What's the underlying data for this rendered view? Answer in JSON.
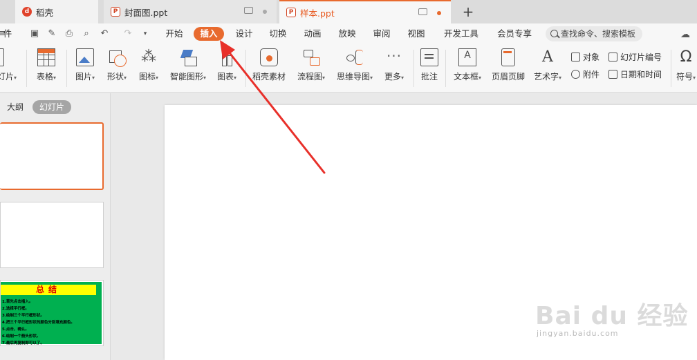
{
  "tabs": [
    {
      "label": "稻壳",
      "icon": "daoke-icon"
    },
    {
      "label": "封面图.ppt",
      "icon": "ppt-file-icon"
    },
    {
      "label": "样本.ppt",
      "icon": "ppt-file-icon",
      "active": true
    }
  ],
  "menu": {
    "file_partial": "件",
    "items": [
      "开始",
      "插入",
      "设计",
      "切换",
      "动画",
      "放映",
      "审阅",
      "视图",
      "开发工具",
      "会员专享"
    ],
    "active": "插入",
    "search_placeholder": "查找命令、搜索模板"
  },
  "ribbon": {
    "buttons": [
      {
        "label": "灯片",
        "icon": "new-slide-icon"
      },
      {
        "label": "表格",
        "icon": "table-icon"
      },
      {
        "label": "图片",
        "icon": "picture-icon"
      },
      {
        "label": "形状",
        "icon": "shape-icon"
      },
      {
        "label": "图标",
        "icon": "icons-icon"
      },
      {
        "label": "智能图形",
        "icon": "smartart-icon"
      },
      {
        "label": "图表",
        "icon": "chart-icon"
      },
      {
        "label": "稻壳素材",
        "icon": "material-icon"
      },
      {
        "label": "流程图",
        "icon": "flowchart-icon"
      },
      {
        "label": "思维导图",
        "icon": "mindmap-icon"
      },
      {
        "label": "更多",
        "icon": "more-icon"
      },
      {
        "label": "批注",
        "icon": "comment-icon"
      },
      {
        "label": "文本框",
        "icon": "textbox-icon"
      },
      {
        "label": "页眉页脚",
        "icon": "header-footer-icon"
      },
      {
        "label": "艺术字",
        "icon": "wordart-icon"
      },
      {
        "label": "符号",
        "icon": "symbol-icon"
      }
    ],
    "small": [
      {
        "label": "对象",
        "icon": "object-icon"
      },
      {
        "label": "附件",
        "icon": "attachment-icon"
      },
      {
        "label": "幻灯片编号",
        "icon": "slide-number-icon"
      },
      {
        "label": "日期和时间",
        "icon": "date-time-icon"
      }
    ]
  },
  "panel": {
    "tab_outline": "大纲",
    "tab_slides": "幻灯片",
    "slide3": {
      "title": "总结",
      "lines": [
        "1.首先点击插入。",
        "2.选择平行框。",
        "3.绘制三个平行框形状。",
        "4.把三个平行框形状的颜色分别填充颜色。",
        "5.点击，确认。",
        "6.绘制一个箭头形状。",
        "7.最后再复制即可以了。"
      ]
    }
  },
  "watermark": {
    "main": "Bai du 经验",
    "sub": "jingyan.baidu.com"
  },
  "colors": {
    "accent": "#e86a2e",
    "arrow": "#e8302a"
  }
}
